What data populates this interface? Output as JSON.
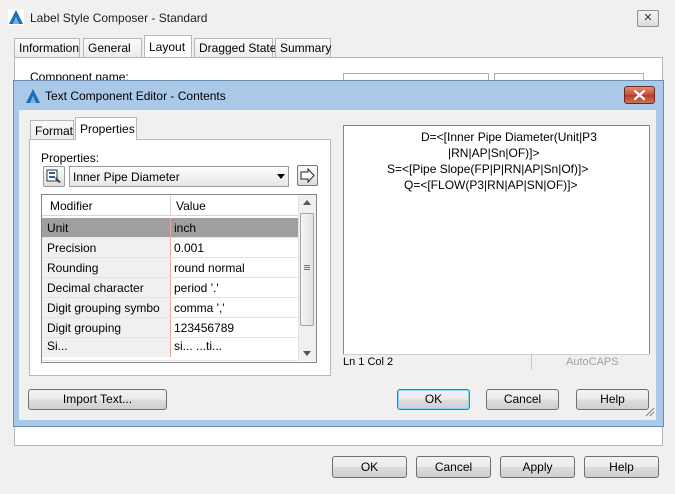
{
  "parent_window": {
    "title": "Label Style Composer - Standard",
    "close_glyph": "✕",
    "tabs": [
      "Information",
      "General",
      "Layout",
      "Dragged State",
      "Summary"
    ],
    "active_tab": "Layout",
    "component_name_label": "Component name:",
    "buttons": {
      "ok": "OK",
      "cancel": "Cancel",
      "apply": "Apply",
      "help": "Help"
    }
  },
  "dialog": {
    "title": "Text Component Editor - Contents",
    "tabs": [
      "Format",
      "Properties"
    ],
    "active_tab": "Properties",
    "properties_label": "Properties:",
    "selected_property": "Inner Pipe Diameter",
    "grid": {
      "columns": [
        "Modifier",
        "Value"
      ],
      "rows": [
        {
          "modifier": "Unit",
          "value": "inch",
          "selected": true
        },
        {
          "modifier": "Precision",
          "value": "0.001"
        },
        {
          "modifier": "Rounding",
          "value": "round normal"
        },
        {
          "modifier": "Decimal character",
          "value": "period '.'"
        },
        {
          "modifier": "Digit grouping symbo",
          "value": "comma ','"
        },
        {
          "modifier": "Digit grouping",
          "value": "123456789"
        },
        {
          "modifier": "Si...",
          "value": "si... ...ti..."
        }
      ]
    },
    "editor_lines": [
      "D=<[Inner Pipe Diameter(Unit|P3",
      "|RN|AP|Sn|OF)]>",
      "S=<[Pipe Slope(FP|P|RN|AP|Sn|Of)]>",
      "Q=<[FLOW(P3|RN|AP|SN|OF)]>"
    ],
    "status": {
      "position": "Ln 1 Col 2",
      "caps": "AutoCAPS"
    },
    "buttons": {
      "import": "Import Text...",
      "ok": "OK",
      "cancel": "Cancel",
      "help": "Help"
    }
  }
}
